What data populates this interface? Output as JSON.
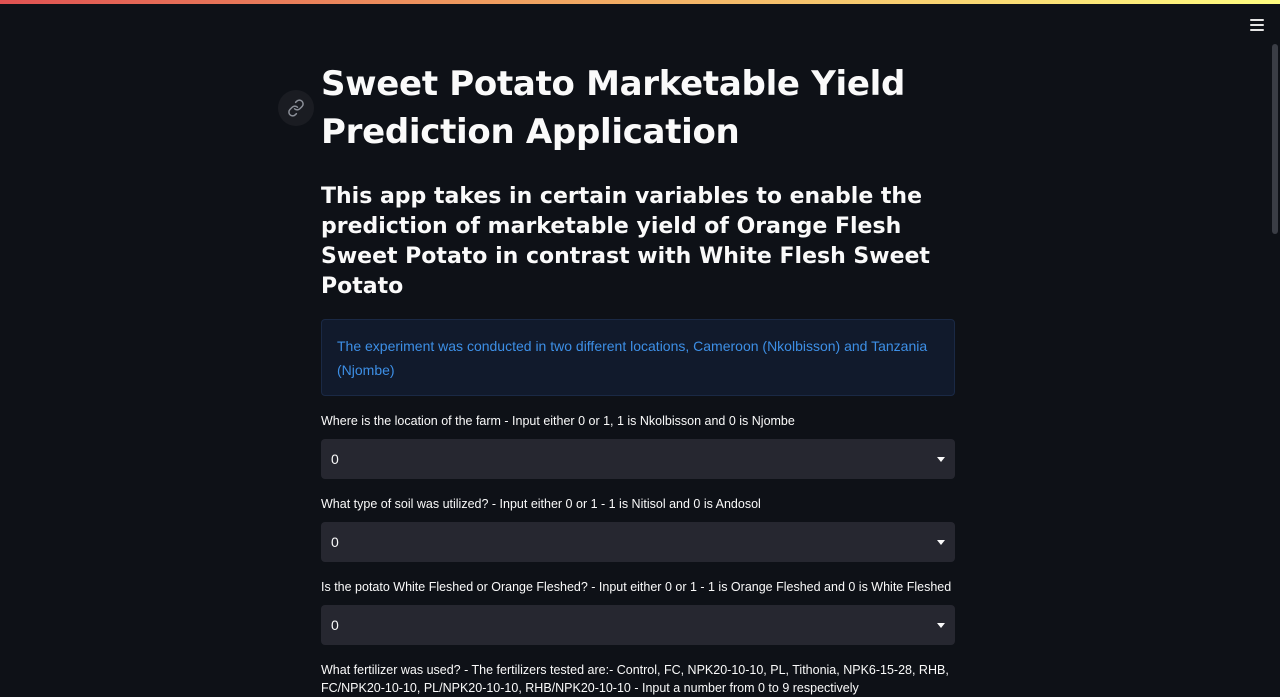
{
  "header": {
    "menu_icon": "hamburger-menu-icon",
    "accent_gradient": [
      "#e05252",
      "#f0a060",
      "#fffd80"
    ]
  },
  "anchor_icon": "link-icon",
  "main": {
    "title": "Sweet Potato Marketable Yield Prediction Application",
    "subtitle": "This app takes in certain variables to enable the prediction of marketable yield of Orange Flesh Sweet Potato in contrast with White Flesh Sweet Potato",
    "info": "The experiment was conducted in two different locations, Cameroon (Nkolbisson) and Tanzania (Njombe)",
    "fields": [
      {
        "label": "Where is the location of the farm - Input either 0 or 1, 1 is Nkolbisson and 0 is Njombe",
        "value": "0"
      },
      {
        "label": "What type of soil was utilized? - Input either 0 or 1 - 1 is Nitisol and 0 is Andosol",
        "value": "0"
      },
      {
        "label": "Is the potato White Fleshed or Orange Fleshed? - Input either 0 or 1 - 1 is Orange Fleshed and 0 is White Fleshed",
        "value": "0"
      },
      {
        "label": "What fertilizer was used? - The fertilizers tested are:- Control, FC, NPK20-10-10, PL, Tithonia, NPK6-15-28, RHB, FC/NPK20-10-10, PL/NPK20-10-10, RHB/NPK20-10-10 - Input a number from 0 to 9 respectively"
      }
    ]
  },
  "colors": {
    "background": "#0e1117",
    "info_text": "#3d8fe6",
    "select_bg": "#262730"
  }
}
